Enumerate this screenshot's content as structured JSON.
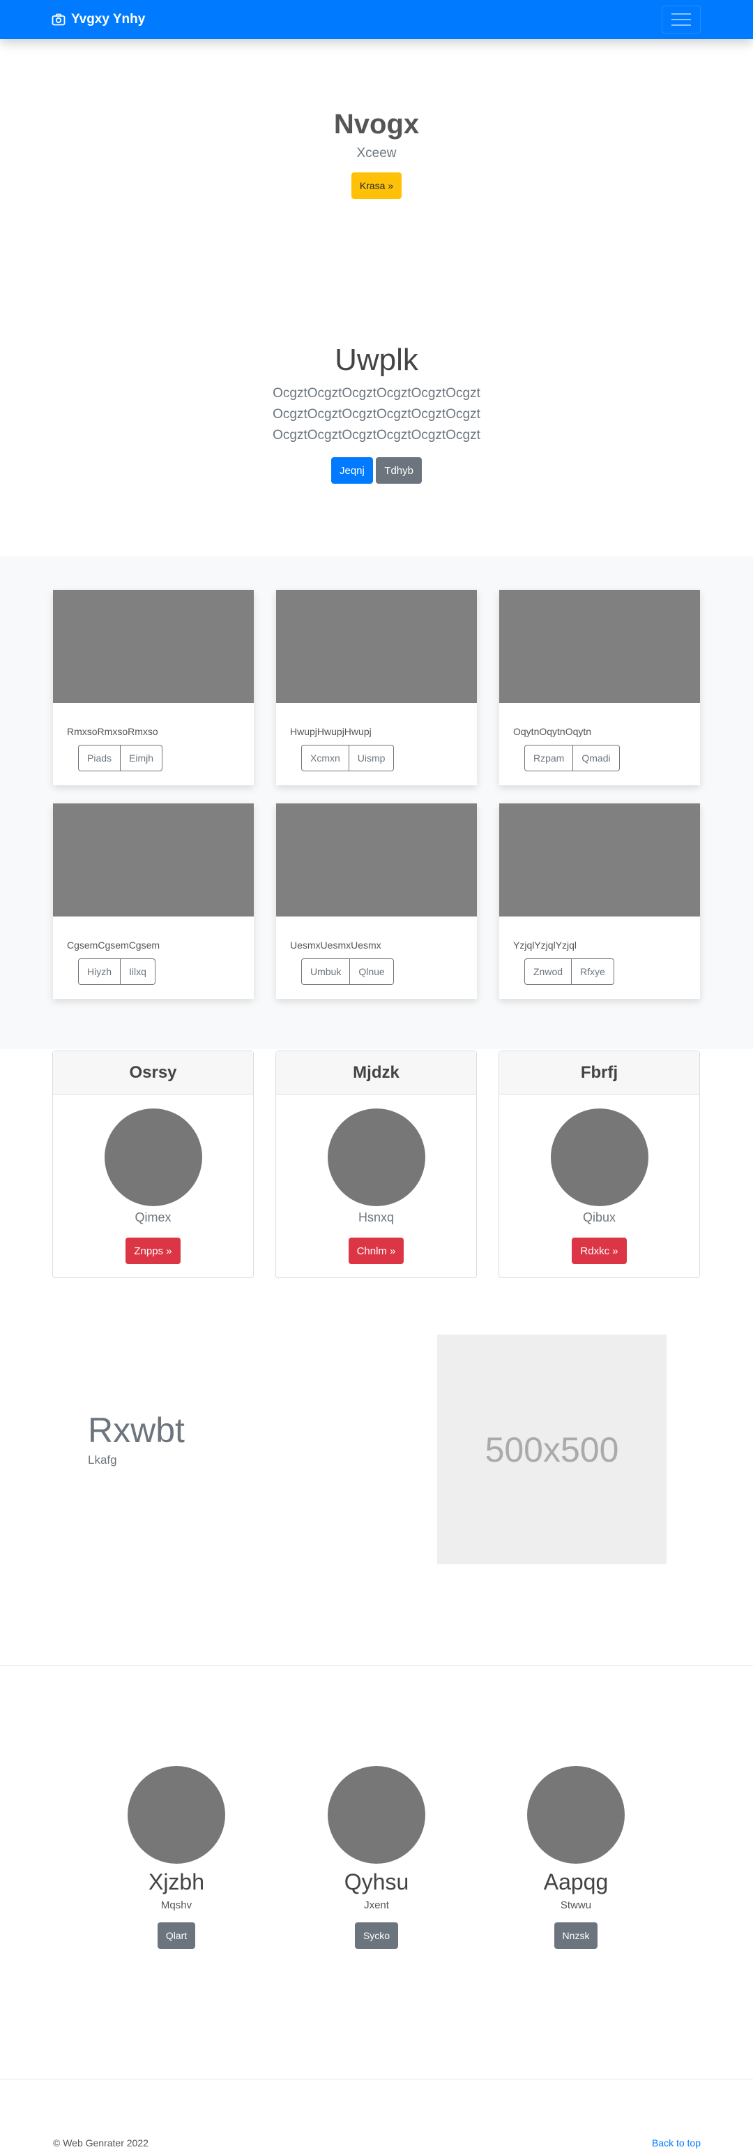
{
  "navbar": {
    "brand": "Yvgxy Ynhy",
    "brand_icon": "camera-icon",
    "toggler_icon": "hamburger-icon"
  },
  "hero": {
    "title": "Nvogx",
    "subtitle": "Xceew",
    "button": "Krasa »"
  },
  "intro": {
    "title": "Uwplk",
    "lines": [
      "OcgztOcgztOcgztOcgztOcgztOcgzt",
      "OcgztOcgztOcgztOcgztOcgztOcgzt",
      "OcgztOcgztOcgztOcgztOcgztOcgzt"
    ],
    "primary_button": "Jeqnj",
    "secondary_button": "Tdhyb"
  },
  "album": [
    {
      "text": "RmxsoRmxsoRmxso",
      "buttons": [
        "Piads",
        "Eimjh"
      ]
    },
    {
      "text": "HwupjHwupjHwupj",
      "buttons": [
        "Xcmxn",
        "Uismp"
      ]
    },
    {
      "text": "OqytnOqytnOqytn",
      "buttons": [
        "Rzpam",
        "Qmadi"
      ]
    },
    {
      "text": "CgsemCgsemCgsem",
      "buttons": [
        "Hiyzh",
        "Iilxq"
      ]
    },
    {
      "text": "UesmxUesmxUesmx",
      "buttons": [
        "Umbuk",
        "Qlnue"
      ]
    },
    {
      "text": "YzjqlYzjqlYzjql",
      "buttons": [
        "Znwod",
        "Rfxye"
      ]
    }
  ],
  "pricing": [
    {
      "header": "Osrsy",
      "name": "Qimex",
      "button": "Znpps »"
    },
    {
      "header": "Mjdzk",
      "name": "Hsnxq",
      "button": "Chnlm »"
    },
    {
      "header": "Fbrfj",
      "name": "Qibux",
      "button": "Rdxkc »"
    }
  ],
  "feature": {
    "title": "Rxwbt",
    "subtitle": "Lkafg",
    "image_label": "500x500"
  },
  "team": [
    {
      "name": "Xjzbh",
      "role": "Mqshv",
      "button": "Qlart"
    },
    {
      "name": "Qyhsu",
      "role": "Jxent",
      "button": "Sycko"
    },
    {
      "name": "Aapqg",
      "role": "Stwwu",
      "button": "Nnzsk"
    }
  ],
  "footer": {
    "copyright": "© Web Genrater 2022",
    "back_to_top": "Back to top"
  }
}
